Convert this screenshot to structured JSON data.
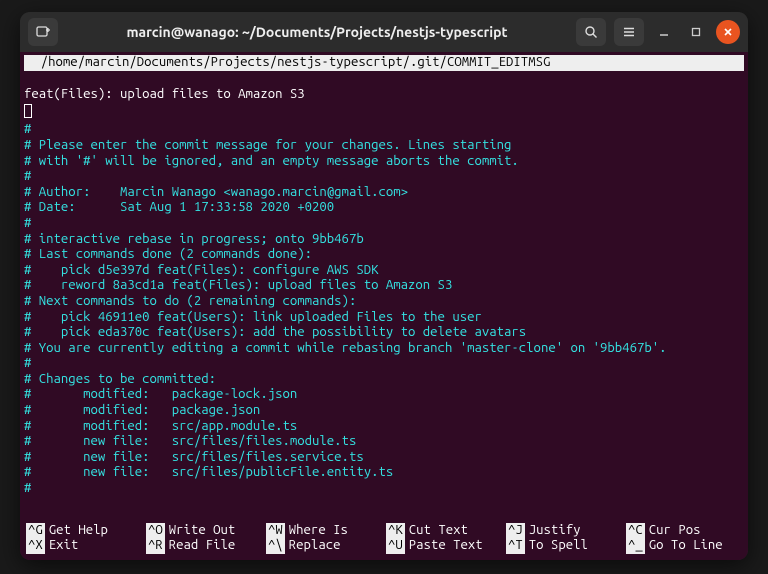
{
  "titlebar": {
    "title": "marcin@wanago: ~/Documents/Projects/nestjs-typescript"
  },
  "editor": {
    "path_prefix": "  /home/marcin/Documents/Projects/nestjs-typescript/.git/",
    "path_file": "COMMIT_EDITMSG",
    "commit_message": "feat(Files): upload files to Amazon S3",
    "lines": [
      "#",
      "# Please enter the commit message for your changes. Lines starting",
      "# with '#' will be ignored, and an empty message aborts the commit.",
      "#",
      "# Author:    Marcin Wanago <wanago.marcin@gmail.com>",
      "# Date:      Sat Aug 1 17:33:58 2020 +0200",
      "#",
      "# interactive rebase in progress; onto 9bb467b",
      "# Last commands done (2 commands done):",
      "#    pick d5e397d feat(Files): configure AWS SDK",
      "#    reword 8a3cd1a feat(Files): upload files to Amazon S3",
      "# Next commands to do (2 remaining commands):",
      "#    pick 46911e0 feat(Users): link uploaded Files to the user",
      "#    pick eda370c feat(Users): add the possibility to delete avatars",
      "# You are currently editing a commit while rebasing branch 'master-clone' on '9bb467b'.",
      "#",
      "# Changes to be committed:",
      "#       modified:   package-lock.json",
      "#       modified:   package.json",
      "#       modified:   src/app.module.ts",
      "#       new file:   src/files/files.module.ts",
      "#       new file:   src/files/files.service.ts",
      "#       new file:   src/files/publicFile.entity.ts",
      "#"
    ]
  },
  "shortcuts": {
    "row1": [
      {
        "key": "^G",
        "label": "Get Help"
      },
      {
        "key": "^O",
        "label": "Write Out"
      },
      {
        "key": "^W",
        "label": "Where Is"
      },
      {
        "key": "^K",
        "label": "Cut Text"
      },
      {
        "key": "^J",
        "label": "Justify"
      },
      {
        "key": "^C",
        "label": "Cur Pos"
      }
    ],
    "row2": [
      {
        "key": "^X",
        "label": "Exit"
      },
      {
        "key": "^R",
        "label": "Read File"
      },
      {
        "key": "^\\",
        "label": "Replace"
      },
      {
        "key": "^U",
        "label": "Paste Text"
      },
      {
        "key": "^T",
        "label": "To Spell"
      },
      {
        "key": "^_",
        "label": "Go To Line"
      }
    ]
  }
}
